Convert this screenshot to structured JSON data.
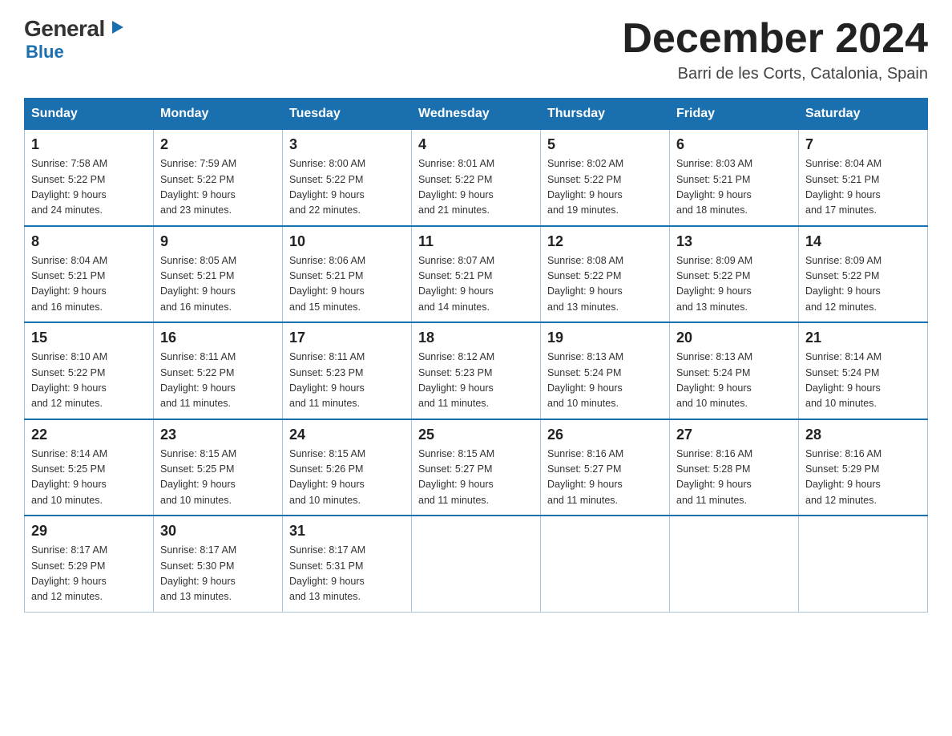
{
  "logo": {
    "general": "General",
    "blue": "Blue",
    "triangle_aria": "triangle logo mark"
  },
  "title": {
    "month_year": "December 2024",
    "location": "Barri de les Corts, Catalonia, Spain"
  },
  "days_of_week": [
    "Sunday",
    "Monday",
    "Tuesday",
    "Wednesday",
    "Thursday",
    "Friday",
    "Saturday"
  ],
  "weeks": [
    [
      {
        "day": "1",
        "info": "Sunrise: 7:58 AM\nSunset: 5:22 PM\nDaylight: 9 hours\nand 24 minutes."
      },
      {
        "day": "2",
        "info": "Sunrise: 7:59 AM\nSunset: 5:22 PM\nDaylight: 9 hours\nand 23 minutes."
      },
      {
        "day": "3",
        "info": "Sunrise: 8:00 AM\nSunset: 5:22 PM\nDaylight: 9 hours\nand 22 minutes."
      },
      {
        "day": "4",
        "info": "Sunrise: 8:01 AM\nSunset: 5:22 PM\nDaylight: 9 hours\nand 21 minutes."
      },
      {
        "day": "5",
        "info": "Sunrise: 8:02 AM\nSunset: 5:22 PM\nDaylight: 9 hours\nand 19 minutes."
      },
      {
        "day": "6",
        "info": "Sunrise: 8:03 AM\nSunset: 5:21 PM\nDaylight: 9 hours\nand 18 minutes."
      },
      {
        "day": "7",
        "info": "Sunrise: 8:04 AM\nSunset: 5:21 PM\nDaylight: 9 hours\nand 17 minutes."
      }
    ],
    [
      {
        "day": "8",
        "info": "Sunrise: 8:04 AM\nSunset: 5:21 PM\nDaylight: 9 hours\nand 16 minutes."
      },
      {
        "day": "9",
        "info": "Sunrise: 8:05 AM\nSunset: 5:21 PM\nDaylight: 9 hours\nand 16 minutes."
      },
      {
        "day": "10",
        "info": "Sunrise: 8:06 AM\nSunset: 5:21 PM\nDaylight: 9 hours\nand 15 minutes."
      },
      {
        "day": "11",
        "info": "Sunrise: 8:07 AM\nSunset: 5:21 PM\nDaylight: 9 hours\nand 14 minutes."
      },
      {
        "day": "12",
        "info": "Sunrise: 8:08 AM\nSunset: 5:22 PM\nDaylight: 9 hours\nand 13 minutes."
      },
      {
        "day": "13",
        "info": "Sunrise: 8:09 AM\nSunset: 5:22 PM\nDaylight: 9 hours\nand 13 minutes."
      },
      {
        "day": "14",
        "info": "Sunrise: 8:09 AM\nSunset: 5:22 PM\nDaylight: 9 hours\nand 12 minutes."
      }
    ],
    [
      {
        "day": "15",
        "info": "Sunrise: 8:10 AM\nSunset: 5:22 PM\nDaylight: 9 hours\nand 12 minutes."
      },
      {
        "day": "16",
        "info": "Sunrise: 8:11 AM\nSunset: 5:22 PM\nDaylight: 9 hours\nand 11 minutes."
      },
      {
        "day": "17",
        "info": "Sunrise: 8:11 AM\nSunset: 5:23 PM\nDaylight: 9 hours\nand 11 minutes."
      },
      {
        "day": "18",
        "info": "Sunrise: 8:12 AM\nSunset: 5:23 PM\nDaylight: 9 hours\nand 11 minutes."
      },
      {
        "day": "19",
        "info": "Sunrise: 8:13 AM\nSunset: 5:24 PM\nDaylight: 9 hours\nand 10 minutes."
      },
      {
        "day": "20",
        "info": "Sunrise: 8:13 AM\nSunset: 5:24 PM\nDaylight: 9 hours\nand 10 minutes."
      },
      {
        "day": "21",
        "info": "Sunrise: 8:14 AM\nSunset: 5:24 PM\nDaylight: 9 hours\nand 10 minutes."
      }
    ],
    [
      {
        "day": "22",
        "info": "Sunrise: 8:14 AM\nSunset: 5:25 PM\nDaylight: 9 hours\nand 10 minutes."
      },
      {
        "day": "23",
        "info": "Sunrise: 8:15 AM\nSunset: 5:25 PM\nDaylight: 9 hours\nand 10 minutes."
      },
      {
        "day": "24",
        "info": "Sunrise: 8:15 AM\nSunset: 5:26 PM\nDaylight: 9 hours\nand 10 minutes."
      },
      {
        "day": "25",
        "info": "Sunrise: 8:15 AM\nSunset: 5:27 PM\nDaylight: 9 hours\nand 11 minutes."
      },
      {
        "day": "26",
        "info": "Sunrise: 8:16 AM\nSunset: 5:27 PM\nDaylight: 9 hours\nand 11 minutes."
      },
      {
        "day": "27",
        "info": "Sunrise: 8:16 AM\nSunset: 5:28 PM\nDaylight: 9 hours\nand 11 minutes."
      },
      {
        "day": "28",
        "info": "Sunrise: 8:16 AM\nSunset: 5:29 PM\nDaylight: 9 hours\nand 12 minutes."
      }
    ],
    [
      {
        "day": "29",
        "info": "Sunrise: 8:17 AM\nSunset: 5:29 PM\nDaylight: 9 hours\nand 12 minutes."
      },
      {
        "day": "30",
        "info": "Sunrise: 8:17 AM\nSunset: 5:30 PM\nDaylight: 9 hours\nand 13 minutes."
      },
      {
        "day": "31",
        "info": "Sunrise: 8:17 AM\nSunset: 5:31 PM\nDaylight: 9 hours\nand 13 minutes."
      },
      null,
      null,
      null,
      null
    ]
  ]
}
